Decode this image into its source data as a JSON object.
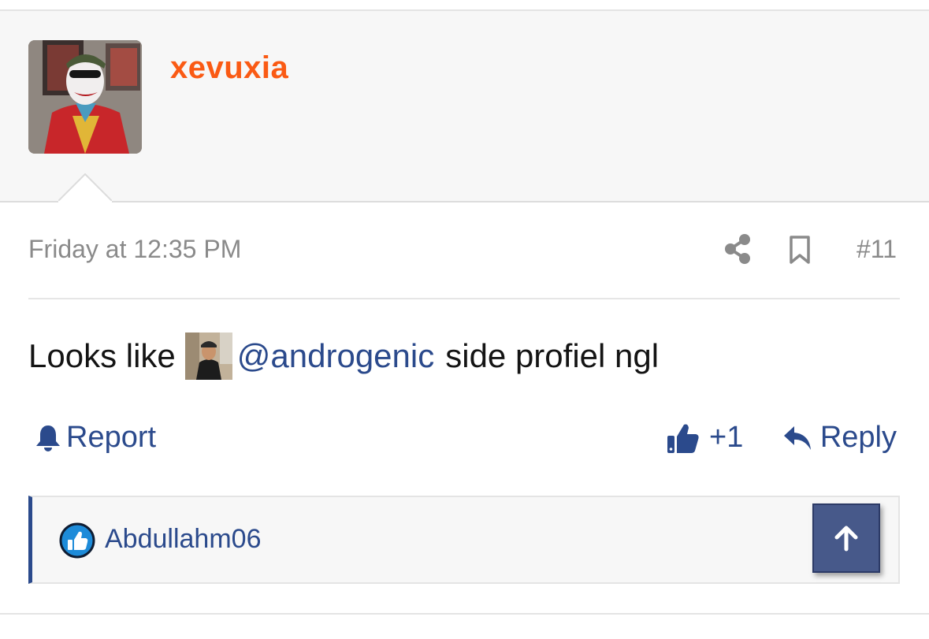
{
  "post": {
    "username": "xevuxia",
    "date": "Friday at 12:35 PM",
    "number": "#11",
    "body_prefix": "Looks like",
    "mention": "@androgenic",
    "body_suffix": "side profiel ngl"
  },
  "actions": {
    "report_label": "Report",
    "like_count": "+1",
    "reply_label": "Reply"
  },
  "reactions": {
    "reactor": "Abdullahm06"
  },
  "icons": {
    "share": "share-icon",
    "bookmark": "bookmark-icon",
    "report": "bell-icon",
    "like": "thumbs-up-icon",
    "reply": "reply-arrow-icon",
    "reaction_badge": "like-badge-icon",
    "scroll_top": "arrow-up-icon"
  },
  "colors": {
    "username": "#fa5a14",
    "link": "#2b4a8c",
    "meta_text": "#8a8a8a",
    "scroll_button": "#47598a",
    "header_bg": "#f7f7f7"
  }
}
